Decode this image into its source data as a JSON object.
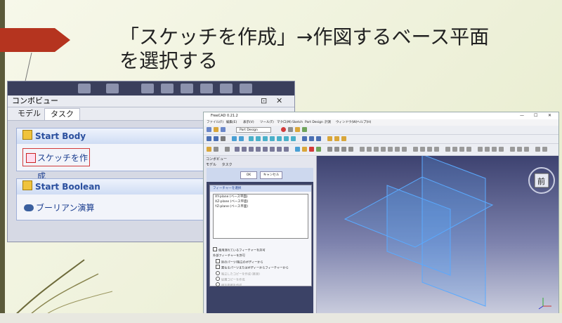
{
  "slide": {
    "title_line1": "「スケッチを作成」→作図するベース平面",
    "title_line2": "を選択する"
  },
  "combo_view": {
    "title": "コンボビュー",
    "controls": [
      "⊡",
      "✕"
    ],
    "tabs": [
      "モデル",
      "タスク"
    ],
    "active_tab": "タスク",
    "start_body": {
      "header": "Start Body",
      "button": "スケッチを作成"
    },
    "start_boolean": {
      "header": "Start Boolean",
      "item": "ブーリアン演算"
    }
  },
  "freecad": {
    "title": "FreeCAD 0.21.2",
    "window_controls": [
      "—",
      "☐",
      "✕"
    ],
    "menu": [
      "ファイル(F)",
      "編集(E)",
      "表示(V)",
      "ツール(T)",
      "マクロ(M)",
      "Sketch",
      "Part Design",
      "計測",
      "ウィンドウ(W)",
      "ヘルプ(H)"
    ],
    "workbench": "Part Design",
    "combo_title": "コンボビュー",
    "tabs": [
      "モデル",
      "タスク"
    ],
    "ok": "OK",
    "cancel": "キャンセル",
    "select_header": "フィーチャーを選択",
    "planes": [
      "XY-plane (ベース平面)",
      "XZ-plane (ベース平面)",
      "YZ-plane (ベース平面)"
    ],
    "options": {
      "allow_used": "使用済れているフィーチャーを許可",
      "external_label": "外部フィーチャーを許可",
      "other_parts": "別のパーツ/独立のボディーから",
      "other_bodies": "異なるパーツまたはボディーからフィーチャーから",
      "dependent_copy": "独立したコピーを作成 (推奨)",
      "dependent_copy2": "従属コピーを作成",
      "cross_ref": "相互参照を作成"
    },
    "navcube_label": "前"
  }
}
